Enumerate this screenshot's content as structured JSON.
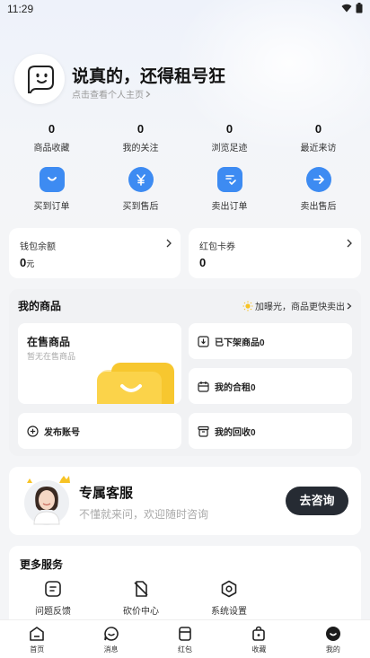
{
  "status_bar": {
    "time": "11:29"
  },
  "profile": {
    "username": "说真的，还得租号狂",
    "subline": "点击查看个人主页"
  },
  "stats": [
    {
      "value": "0",
      "label": "商品收藏"
    },
    {
      "value": "0",
      "label": "我的关注"
    },
    {
      "value": "0",
      "label": "浏览足迹"
    },
    {
      "value": "0",
      "label": "最近来访"
    }
  ],
  "orders": [
    {
      "label": "买到订单",
      "icon": "bag-smile-icon"
    },
    {
      "label": "买到售后",
      "icon": "yen-icon"
    },
    {
      "label": "卖出订单",
      "icon": "document-check-icon"
    },
    {
      "label": "卖出售后",
      "icon": "arrow-right-icon"
    }
  ],
  "wallet": {
    "title": "钱包余额",
    "value": "0",
    "unit": "元"
  },
  "coupon": {
    "title": "红包卡券",
    "value": "0"
  },
  "goods": {
    "title": "我的商品",
    "promo": "加曝光，商品更快卖出",
    "on_sale_title": "在售商品",
    "on_sale_sub": "暂无在售商品",
    "offline": "已下架商品0",
    "co_rent": "我的合租0",
    "publish": "发布账号",
    "recycle": "我的回收0"
  },
  "service": {
    "title": "专属客服",
    "subtitle": "不懂就来问，欢迎随时咨询",
    "button": "去咨询"
  },
  "more": {
    "title": "更多服务",
    "items": [
      {
        "label": "问题反馈",
        "icon": "feedback-icon"
      },
      {
        "label": "砍价中心",
        "icon": "price-tag-icon"
      },
      {
        "label": "系统设置",
        "icon": "settings-hex-icon"
      }
    ]
  },
  "tabbar": [
    {
      "label": "首页",
      "icon": "home-icon"
    },
    {
      "label": "消息",
      "icon": "message-icon"
    },
    {
      "label": "红包",
      "icon": "red-packet-icon"
    },
    {
      "label": "收藏",
      "icon": "favorite-bag-icon"
    },
    {
      "label": "我的",
      "icon": "profile-icon"
    }
  ],
  "colors": {
    "accent_blue": "#3d8bf2",
    "dark_button": "#262b33",
    "promo_yellow": "#f7c325"
  }
}
